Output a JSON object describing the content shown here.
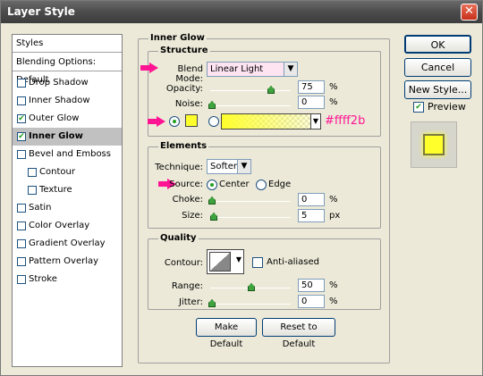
{
  "window": {
    "title": "Layer Style"
  },
  "styles_panel": {
    "header": "Styles",
    "blending": "Blending Options: Default",
    "items": [
      {
        "label": "Drop Shadow",
        "checked": false
      },
      {
        "label": "Inner Shadow",
        "checked": false
      },
      {
        "label": "Outer Glow",
        "checked": true
      },
      {
        "label": "Inner Glow",
        "checked": true,
        "selected": true
      },
      {
        "label": "Bevel and Emboss",
        "checked": false
      },
      {
        "label": "Contour",
        "checked": false
      },
      {
        "label": "Texture",
        "checked": false
      },
      {
        "label": "Satin",
        "checked": false
      },
      {
        "label": "Color Overlay",
        "checked": false
      },
      {
        "label": "Gradient Overlay",
        "checked": false
      },
      {
        "label": "Pattern Overlay",
        "checked": false
      },
      {
        "label": "Stroke",
        "checked": false
      }
    ]
  },
  "inner_glow": {
    "title": "Inner Glow",
    "structure": {
      "title": "Structure",
      "blend_mode_label": "Blend Mode:",
      "blend_mode": "Linear Light",
      "opacity_label": "Opacity:",
      "opacity": "75",
      "opacity_unit": "%",
      "noise_label": "Noise:",
      "noise": "0",
      "noise_unit": "%",
      "color_hex": "#ffff2b",
      "swatch_color": "#ffff2b"
    },
    "elements": {
      "title": "Elements",
      "technique_label": "Technique:",
      "technique": "Softer",
      "source_label": "Source:",
      "source_center": "Center",
      "source_edge": "Edge",
      "choke_label": "Choke:",
      "choke": "0",
      "choke_unit": "%",
      "size_label": "Size:",
      "size": "5",
      "size_unit": "px"
    },
    "quality": {
      "title": "Quality",
      "contour_label": "Contour:",
      "anti_aliased": "Anti-aliased",
      "range_label": "Range:",
      "range": "50",
      "range_unit": "%",
      "jitter_label": "Jitter:",
      "jitter": "0",
      "jitter_unit": "%"
    },
    "make_default": "Make Default",
    "reset_default": "Reset to Default"
  },
  "buttons": {
    "ok": "OK",
    "cancel": "Cancel",
    "new_style": "New Style...",
    "preview": "Preview"
  },
  "colors": {
    "accent": "#ff1493",
    "glow": "#ffff2b"
  }
}
